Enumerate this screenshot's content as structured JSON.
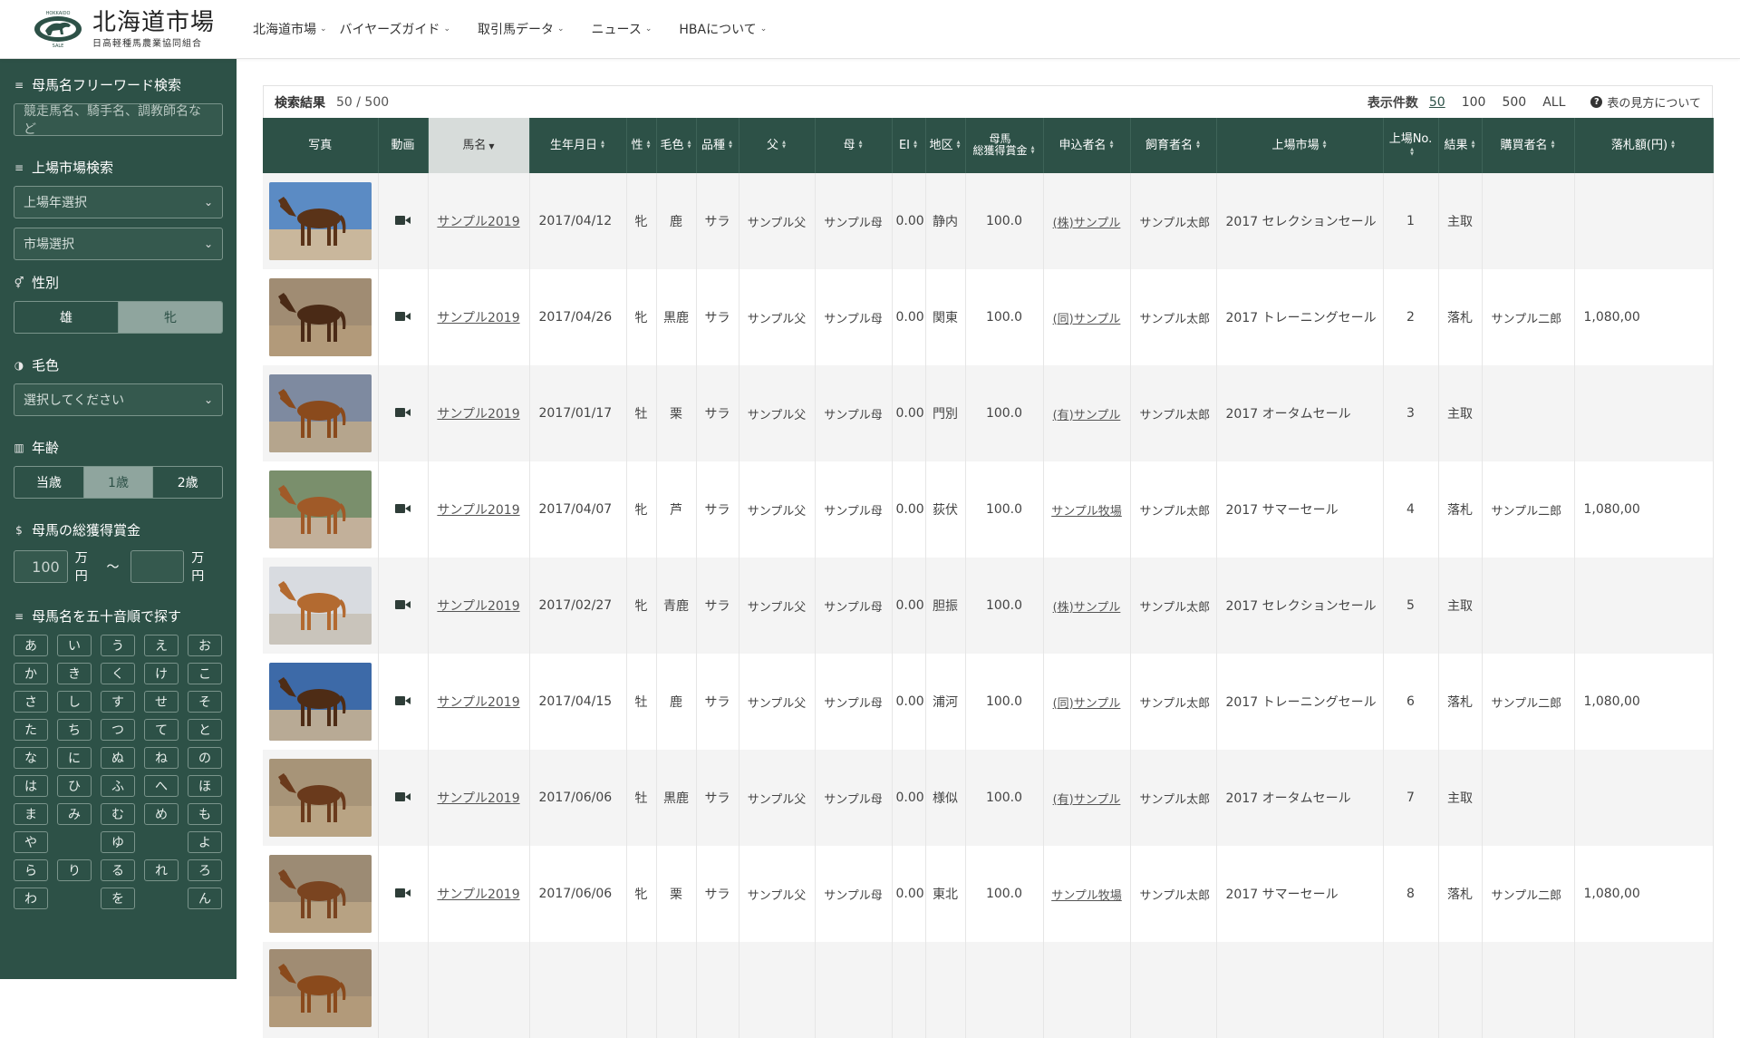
{
  "header": {
    "logo_title": "北海道市場",
    "logo_sub": "日高軽種馬農業協同組合",
    "logo_emblem_text_top": "HOKKAIDO",
    "logo_emblem_text_bottom": "SALE",
    "nav": [
      {
        "label": "北海道市場"
      },
      {
        "label": "バイヤーズガイド"
      },
      {
        "label": "取引馬データ"
      },
      {
        "label": "ニュース"
      },
      {
        "label": "HBAについて"
      }
    ]
  },
  "sidebar": {
    "freeword": {
      "label": "母馬名フリーワード検索",
      "placeholder": "競走馬名、騎手名、調教師名など"
    },
    "market": {
      "label": "上場市場検索",
      "year_select": "上場年選択",
      "market_select": "市場選択"
    },
    "sex": {
      "label": "性別",
      "options": [
        "雄",
        "牝"
      ],
      "active_index": 1
    },
    "color": {
      "label": "毛色",
      "select": "選択してください"
    },
    "age": {
      "label": "年齢",
      "options": [
        "当歳",
        "1歳",
        "2歳"
      ],
      "active_index": 1
    },
    "prize": {
      "label": "母馬の総獲得賞金",
      "min": "100",
      "max": "",
      "unit": "万円",
      "sep": "〜"
    },
    "kana": {
      "label": "母馬名を五十音順で探す",
      "chars": [
        "あ",
        "い",
        "う",
        "え",
        "お",
        "か",
        "き",
        "く",
        "け",
        "こ",
        "さ",
        "し",
        "す",
        "せ",
        "そ",
        "た",
        "ち",
        "つ",
        "て",
        "と",
        "な",
        "に",
        "ぬ",
        "ね",
        "の",
        "は",
        "ひ",
        "ふ",
        "へ",
        "ほ",
        "ま",
        "み",
        "む",
        "め",
        "も",
        "や",
        "",
        "ゆ",
        "",
        "よ",
        "ら",
        "り",
        "る",
        "れ",
        "ろ",
        "わ",
        "",
        "を",
        "",
        "ん"
      ]
    }
  },
  "results": {
    "title": "検索結果",
    "count": "50 / 500",
    "per_page_label": "表示件数",
    "per_page_options": [
      "50",
      "100",
      "500",
      "ALL"
    ],
    "per_page_selected": "50",
    "help": "表の見方について"
  },
  "table": {
    "columns": [
      "写真",
      "動画",
      "馬名",
      "生年月日",
      "性",
      "毛色",
      "品種",
      "父",
      "母",
      "EI",
      "地区",
      "母馬\n総獲得賞金",
      "申込者名",
      "飼育者名",
      "上場市場",
      "上場No.",
      "結果",
      "購買者名",
      "落札額(円)"
    ],
    "rows": [
      {
        "name": "サンプル2019",
        "birth": "2017/04/12",
        "sex": "牝",
        "color": "鹿",
        "breed": "サラ",
        "sire": "サンプル父",
        "dam": "サンプル母",
        "ei": "0.00",
        "area": "静内",
        "prize": "100.0",
        "applicant": "(株)サンプル",
        "breeder": "サンプル太郎",
        "market": "2017 セレクションセール",
        "no": "1",
        "result": "主取",
        "buyer": "",
        "price": ""
      },
      {
        "name": "サンプル2019",
        "birth": "2017/04/26",
        "sex": "牝",
        "color": "黒鹿",
        "breed": "サラ",
        "sire": "サンプル父",
        "dam": "サンプル母",
        "ei": "0.00",
        "area": "関東",
        "prize": "100.0",
        "applicant": "(同)サンプル",
        "breeder": "サンプル太郎",
        "market": "2017 トレーニングセール",
        "no": "2",
        "result": "落札",
        "buyer": "サンプル二郎",
        "price": "1,080,00"
      },
      {
        "name": "サンプル2019",
        "birth": "2017/01/17",
        "sex": "牡",
        "color": "栗",
        "breed": "サラ",
        "sire": "サンプル父",
        "dam": "サンプル母",
        "ei": "0.00",
        "area": "門別",
        "prize": "100.0",
        "applicant": "(有)サンプル",
        "breeder": "サンプル太郎",
        "market": "2017 オータムセール",
        "no": "3",
        "result": "主取",
        "buyer": "",
        "price": ""
      },
      {
        "name": "サンプル2019",
        "birth": "2017/04/07",
        "sex": "牝",
        "color": "芦",
        "breed": "サラ",
        "sire": "サンプル父",
        "dam": "サンプル母",
        "ei": "0.00",
        "area": "荻伏",
        "prize": "100.0",
        "applicant": "サンプル牧場",
        "breeder": "サンプル太郎",
        "market": "2017 サマーセール",
        "no": "4",
        "result": "落札",
        "buyer": "サンプル二郎",
        "price": "1,080,00"
      },
      {
        "name": "サンプル2019",
        "birth": "2017/02/27",
        "sex": "牝",
        "color": "青鹿",
        "breed": "サラ",
        "sire": "サンプル父",
        "dam": "サンプル母",
        "ei": "0.00",
        "area": "胆振",
        "prize": "100.0",
        "applicant": "(株)サンプル",
        "breeder": "サンプル太郎",
        "market": "2017 セレクションセール",
        "no": "5",
        "result": "主取",
        "buyer": "",
        "price": ""
      },
      {
        "name": "サンプル2019",
        "birth": "2017/04/15",
        "sex": "牡",
        "color": "鹿",
        "breed": "サラ",
        "sire": "サンプル父",
        "dam": "サンプル母",
        "ei": "0.00",
        "area": "浦河",
        "prize": "100.0",
        "applicant": "(同)サンプル",
        "breeder": "サンプル太郎",
        "market": "2017 トレーニングセール",
        "no": "6",
        "result": "落札",
        "buyer": "サンプル二郎",
        "price": "1,080,00"
      },
      {
        "name": "サンプル2019",
        "birth": "2017/06/06",
        "sex": "牡",
        "color": "黒鹿",
        "breed": "サラ",
        "sire": "サンプル父",
        "dam": "サンプル母",
        "ei": "0.00",
        "area": "様似",
        "prize": "100.0",
        "applicant": "(有)サンプル",
        "breeder": "サンプル太郎",
        "market": "2017 オータムセール",
        "no": "7",
        "result": "主取",
        "buyer": "",
        "price": ""
      },
      {
        "name": "サンプル2019",
        "birth": "2017/06/06",
        "sex": "牝",
        "color": "栗",
        "breed": "サラ",
        "sire": "サンプル父",
        "dam": "サンプル母",
        "ei": "0.00",
        "area": "東北",
        "prize": "100.0",
        "applicant": "サンプル牧場",
        "breeder": "サンプル太郎",
        "market": "2017 サマーセール",
        "no": "8",
        "result": "落札",
        "buyer": "サンプル二郎",
        "price": "1,080,00"
      },
      {
        "name": "",
        "birth": "",
        "sex": "",
        "color": "",
        "breed": "",
        "sire": "",
        "dam": "",
        "ei": "",
        "area": "",
        "prize": "",
        "applicant": "",
        "breeder": "",
        "market": "",
        "no": "",
        "result": "",
        "buyer": "",
        "price": ""
      }
    ]
  },
  "colors": {
    "sidebar_bg": "#2d5147",
    "header_table_bg": "#2d5147",
    "sorted_col_bg": "#d7dcda"
  }
}
